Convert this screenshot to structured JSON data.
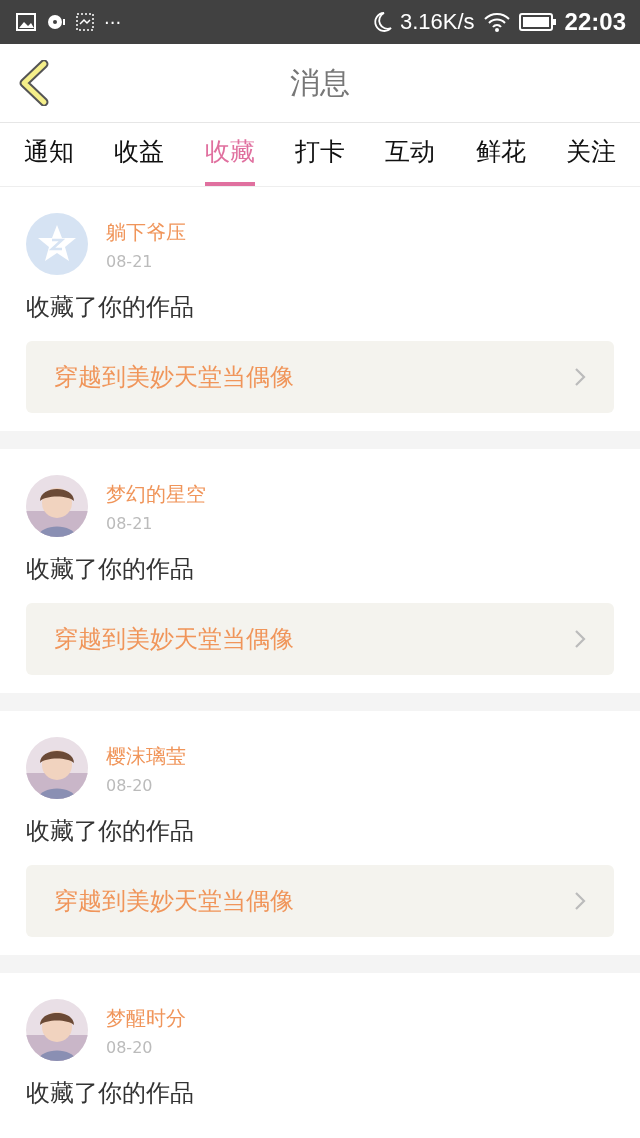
{
  "status_bar": {
    "speed": "3.16K/s",
    "time": "22:03",
    "notifications": "···"
  },
  "header": {
    "title": "消息"
  },
  "tabs": [
    {
      "label": "通知",
      "selected": false
    },
    {
      "label": "收益",
      "selected": false
    },
    {
      "label": "收藏",
      "selected": true
    },
    {
      "label": "打卡",
      "selected": false
    },
    {
      "label": "互动",
      "selected": false
    },
    {
      "label": "鲜花",
      "selected": false
    },
    {
      "label": "关注",
      "selected": false
    }
  ],
  "messages": [
    {
      "avatar": {
        "kind": "default"
      },
      "name": "躺下爷压",
      "date": "08-21",
      "text": "收藏了你的作品",
      "work": "穿越到美妙天堂当偶像"
    },
    {
      "name": "梦幻的星空",
      "date": "08-21",
      "text": "收藏了你的作品",
      "work": "穿越到美妙天堂当偶像"
    },
    {
      "name": "樱沫璃莹",
      "date": "08-20",
      "text": "收藏了你的作品",
      "work": "穿越到美妙天堂当偶像"
    },
    {
      "name": "梦醒时分",
      "date": "08-20",
      "text": "收藏了你的作品"
    }
  ]
}
